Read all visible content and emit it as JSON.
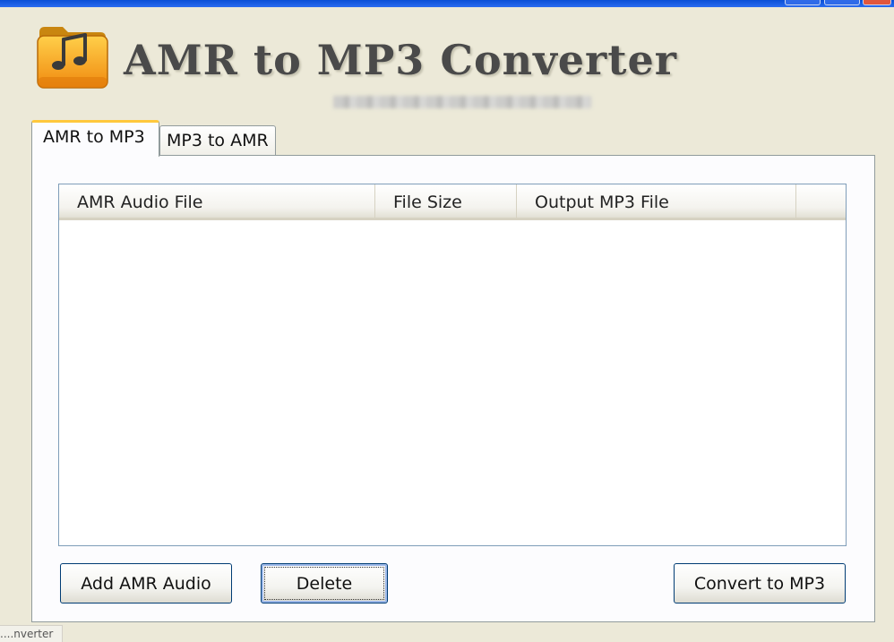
{
  "app": {
    "title": "AMR to MP3 Converter"
  },
  "tabs": [
    {
      "label": "AMR to MP3",
      "active": true
    },
    {
      "label": "MP3 to AMR",
      "active": false
    }
  ],
  "list": {
    "columns": [
      "AMR Audio File",
      "File Size",
      "Output MP3 File",
      ""
    ],
    "rows": []
  },
  "buttons": {
    "add": "Add AMR Audio",
    "delete": "Delete",
    "convert": "Convert to MP3"
  },
  "status": {
    "text": "nverter...."
  },
  "icons": {
    "logo": "music-folder-icon"
  },
  "colors": {
    "titlebar": "#0a4fd6",
    "tab_highlight": "#ffc83c",
    "window_bg": "#ece9d8"
  }
}
